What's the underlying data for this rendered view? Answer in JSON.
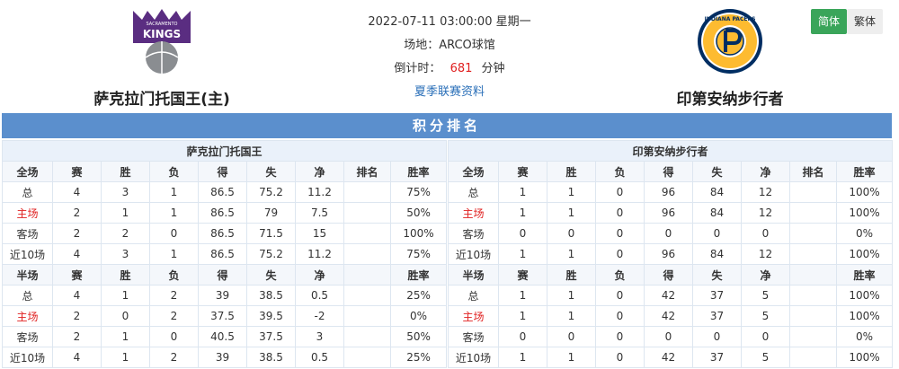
{
  "match": {
    "datetime": "2022-07-11 03:00:00 星期一",
    "venue": "场地：ARCO球馆",
    "countdown_label": "倒计时：",
    "countdown_value": "681",
    "countdown_unit": "分钟",
    "league_link": "夏季联赛资料"
  },
  "home_team": {
    "name": "萨克拉门托国王(主)",
    "logo_text": "KINGS",
    "logo_subtext": "SACRAMENTO",
    "logo_color": "#5a2d81"
  },
  "away_team": {
    "name": "印第安纳步行者",
    "logo_text": "INDIANA PACERS",
    "logo_color": "#002d62",
    "logo_accent": "#fdbb30"
  },
  "lang": {
    "simplified": "简体",
    "traditional": "繁体"
  },
  "section_title": "积分排名",
  "standings": {
    "left": {
      "team": "萨克拉门托国王",
      "full_header": [
        "全场",
        "赛",
        "胜",
        "负",
        "得",
        "失",
        "净",
        "排名",
        "胜率"
      ],
      "full_rows": [
        [
          "总",
          "4",
          "3",
          "1",
          "86.5",
          "75.2",
          "11.2",
          "",
          "75%"
        ],
        [
          "主场",
          "2",
          "1",
          "1",
          "86.5",
          "79",
          "7.5",
          "",
          "50%"
        ],
        [
          "客场",
          "2",
          "2",
          "0",
          "86.5",
          "71.5",
          "15",
          "",
          "100%"
        ],
        [
          "近10场",
          "4",
          "3",
          "1",
          "86.5",
          "75.2",
          "11.2",
          "",
          "75%"
        ]
      ],
      "half_header": [
        "半场",
        "赛",
        "胜",
        "负",
        "得",
        "失",
        "净",
        "",
        "胜率"
      ],
      "half_rows": [
        [
          "总",
          "4",
          "1",
          "2",
          "39",
          "38.5",
          "0.5",
          "",
          "25%"
        ],
        [
          "主场",
          "2",
          "0",
          "2",
          "37.5",
          "39.5",
          "-2",
          "",
          "0%"
        ],
        [
          "客场",
          "2",
          "1",
          "0",
          "40.5",
          "37.5",
          "3",
          "",
          "50%"
        ],
        [
          "近10场",
          "4",
          "1",
          "2",
          "39",
          "38.5",
          "0.5",
          "",
          "25%"
        ]
      ]
    },
    "right": {
      "team": "印第安纳步行者",
      "full_header": [
        "全场",
        "赛",
        "胜",
        "负",
        "得",
        "失",
        "净",
        "排名",
        "胜率"
      ],
      "full_rows": [
        [
          "总",
          "1",
          "1",
          "0",
          "96",
          "84",
          "12",
          "",
          "100%"
        ],
        [
          "主场",
          "1",
          "1",
          "0",
          "96",
          "84",
          "12",
          "",
          "100%"
        ],
        [
          "客场",
          "0",
          "0",
          "0",
          "0",
          "0",
          "0",
          "",
          "0%"
        ],
        [
          "近10场",
          "1",
          "1",
          "0",
          "96",
          "84",
          "12",
          "",
          "100%"
        ]
      ],
      "half_header": [
        "半场",
        "赛",
        "胜",
        "负",
        "得",
        "失",
        "净",
        "",
        "胜率"
      ],
      "half_rows": [
        [
          "总",
          "1",
          "1",
          "0",
          "42",
          "37",
          "5",
          "",
          "100%"
        ],
        [
          "主场",
          "1",
          "1",
          "0",
          "42",
          "37",
          "5",
          "",
          "100%"
        ],
        [
          "客场",
          "0",
          "0",
          "0",
          "0",
          "0",
          "0",
          "",
          "0%"
        ],
        [
          "近10场",
          "1",
          "1",
          "0",
          "42",
          "37",
          "5",
          "",
          "100%"
        ]
      ]
    }
  }
}
